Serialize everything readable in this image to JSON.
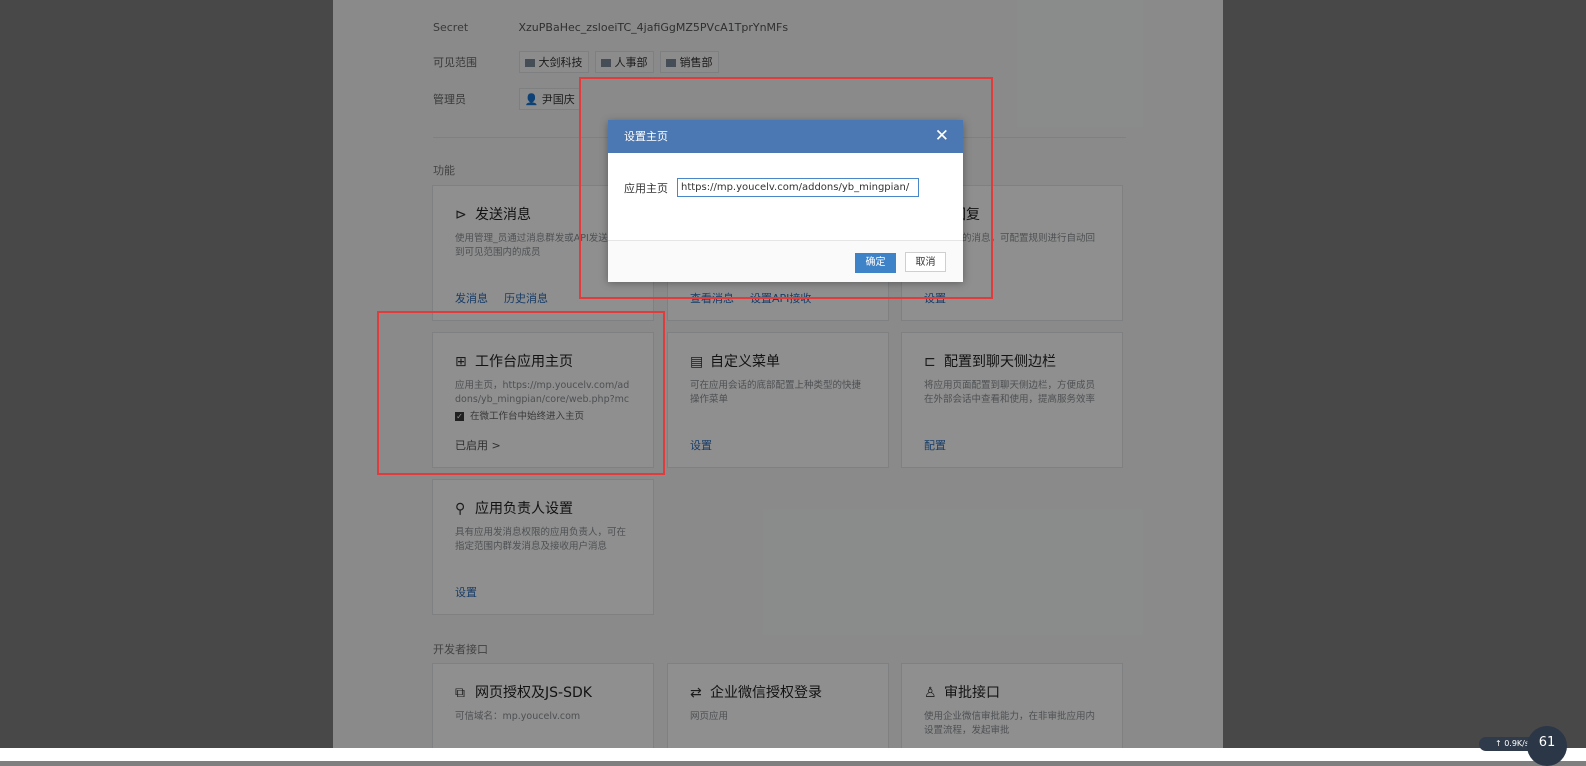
{
  "settings": {
    "secret_label": "Secret",
    "secret_value": "XzuPBaHec_zsloeiTC_4jafiGgMZ5PVcA1TprYnMFs",
    "scope_label": "可见范围",
    "scope_tags": [
      "大剑科技",
      "人事部",
      "销售部"
    ],
    "admin_label": "管理员",
    "admin_value": "尹国庆"
  },
  "functions": {
    "section_title": "功能",
    "cards": [
      {
        "title": "发送消息",
        "icon": "send-icon",
        "desc": "使用管理_员通过消息群发或API发送消息到可见范围内的成员",
        "links": [
          "发消息",
          "历史消息"
        ]
      },
      {
        "title": "",
        "icon": "",
        "desc": "",
        "links": [
          "查看消息",
          "设置API接收"
        ]
      },
      {
        "title": "自动回复",
        "icon": "",
        "desc": "接收用户的消息，可配置规则进行自动回复",
        "links": [
          "设置"
        ]
      },
      {
        "title": "工作台应用主页",
        "icon": "grid-icon",
        "desc": "应用主页，https://mp.youcelv.com/addons/yb_mingpian/core/web.php?mch_id=...",
        "checkbox_label": "在微工作台中始终进入主页",
        "links": [
          "已启用 >"
        ]
      },
      {
        "title": "自定义菜单",
        "icon": "menu-icon",
        "desc": "可在应用会话的底部配置上种类型的快捷操作菜单",
        "links": [
          "设置"
        ]
      },
      {
        "title": "配置到聊天侧边栏",
        "icon": "sidebar-icon",
        "desc": "将应用页面配置到聊天侧边栏，方便成员在外部会话中查看和使用，提高服务效率",
        "links": [
          "配置"
        ]
      },
      {
        "title": "应用负责人设置",
        "icon": "person-icon",
        "desc": "具有应用发消息权限的应用负责人，可在指定范围内群发消息及接收用户消息",
        "links": [
          "设置"
        ]
      }
    ]
  },
  "developer": {
    "section_title": "开发者接口",
    "cards": [
      {
        "title": "网页授权及JS-SDK",
        "icon": "copy-icon",
        "desc": "可信域名：mp.youcelv.com"
      },
      {
        "title": "企业微信授权登录",
        "icon": "swap-icon",
        "desc": "网页应用"
      },
      {
        "title": "审批接口",
        "icon": "stamp-icon",
        "desc": "使用企业微信审批能力，在非审批应用内设置流程，发起审批"
      }
    ]
  },
  "modal": {
    "title": "设置主页",
    "field_label": "应用主页",
    "field_value": "https://mp.youcelv.com/addons/yb_mingpian/",
    "ok_label": "确定",
    "cancel_label": "取消",
    "close_symbol": "✕"
  },
  "status": {
    "speed": "↑ 0.9K/s",
    "corner": "61"
  },
  "colors": {
    "accent": "#4b78b3",
    "link": "#2b6cb8",
    "highlight": "#e23b3b"
  }
}
